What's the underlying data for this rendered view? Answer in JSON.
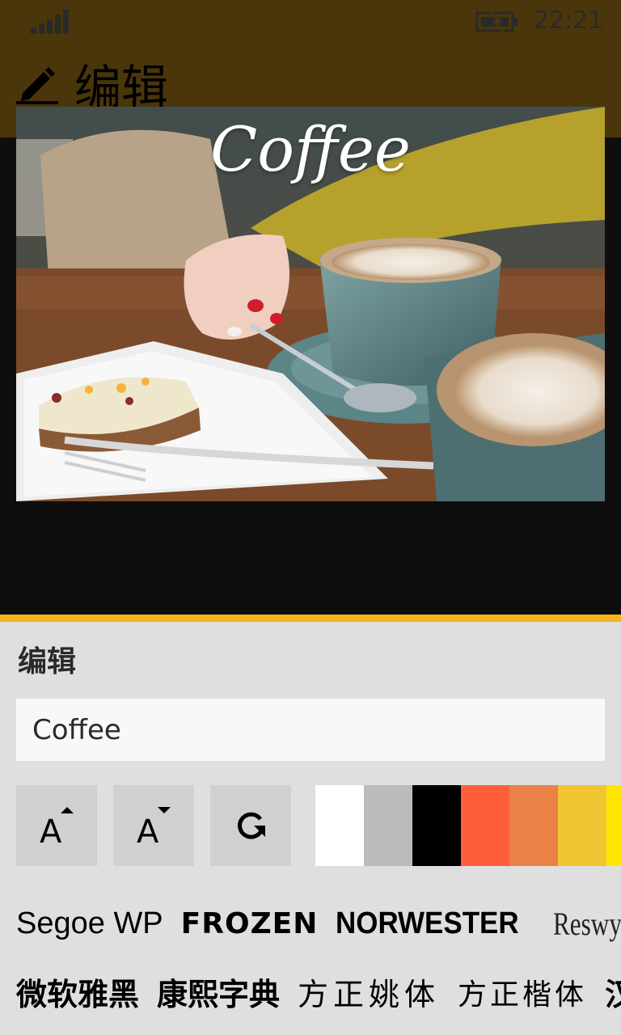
{
  "status_bar": {
    "time": "22:21",
    "signal_icon": "signal-bars-icon",
    "battery_icon": "battery-charging-icon"
  },
  "header": {
    "title": "编辑",
    "icon": "pencil-edit-icon",
    "background": "#4a360a"
  },
  "preview": {
    "overlay_text": "Coffee"
  },
  "panel": {
    "title": "编辑",
    "accent": "#f5b61a",
    "text_value": "Coffee",
    "tools": [
      {
        "name": "increase-font-size-icon"
      },
      {
        "name": "decrease-font-size-icon"
      },
      {
        "name": "rotate-icon"
      }
    ],
    "colors": [
      "#ffffff",
      "#bbbbbb",
      "#000000",
      "#ff5e3a",
      "#ea8147",
      "#f2c533",
      "#ffe600"
    ],
    "fonts_row1": [
      "Segoe WP",
      "FROZEN",
      "NORWESTER",
      "Reswysokr"
    ],
    "fonts_row2": [
      "微软雅黑",
      "康熙字典",
      "方正姚体",
      "方正楷体",
      "汉"
    ]
  }
}
